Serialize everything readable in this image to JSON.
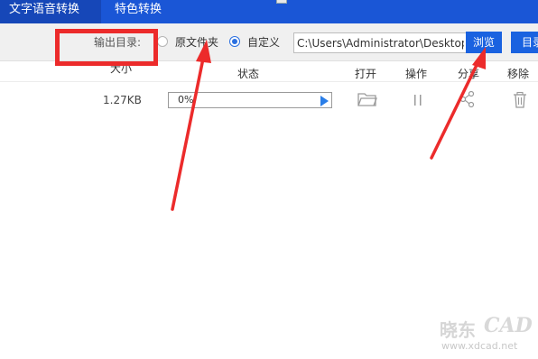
{
  "tabs": {
    "active_label": "文字语音转换",
    "second_label": "特色转换"
  },
  "toolbar": {
    "output_dir_label": "输出目录:",
    "option_original": "原文件夹",
    "option_custom": "自定义",
    "selected_option": "自定义",
    "path_value": "C:\\Users\\Administrator\\Desktop",
    "browse_label": "浏览",
    "dir_label": "目录"
  },
  "table": {
    "headers": {
      "size": "大小",
      "status": "状态",
      "open": "打开",
      "operation": "操作",
      "share": "分享",
      "remove": "移除"
    },
    "rows": [
      {
        "size": "1.27KB",
        "progress_text": "0%",
        "progress": 0.0
      }
    ]
  },
  "icons": {
    "open": "folder-icon",
    "operation": "pause-icon",
    "share": "share-icon",
    "remove": "trash-icon"
  },
  "annotations": {
    "color": "#ec2b2b"
  },
  "watermark": {
    "logo_text": "晓东",
    "cad_text": "CAD",
    "url": "www.xdcad.net"
  },
  "colors": {
    "tabbar": "#1a56d6",
    "button": "#1a62e0",
    "radio_selected": "#2a6fe0"
  }
}
